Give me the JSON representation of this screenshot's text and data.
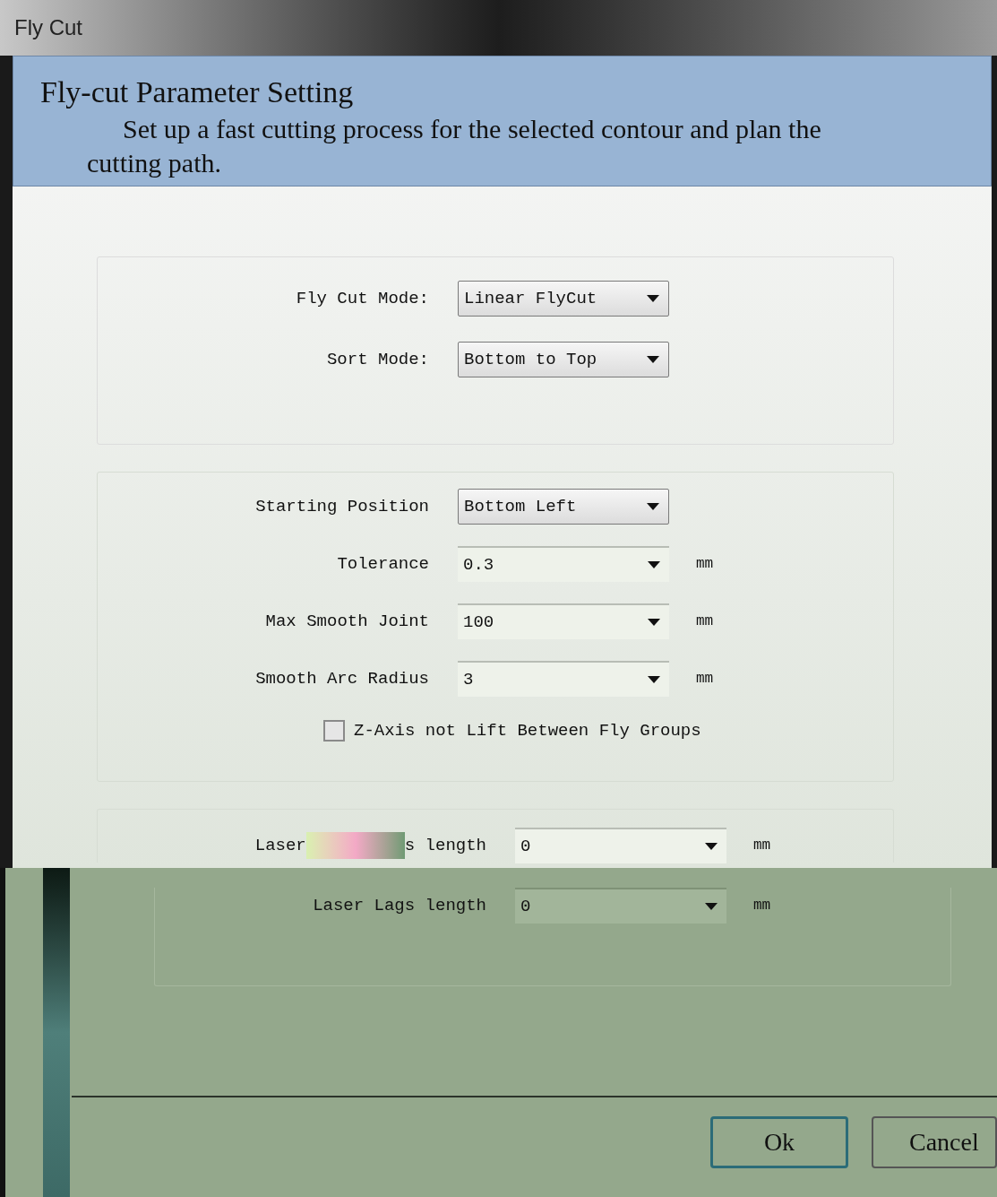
{
  "window": {
    "title": "Fly Cut"
  },
  "header": {
    "title": "Fly-cut Parameter Setting",
    "description": "Set up a fast cutting process for the selected contour and plan the cutting path."
  },
  "group_1": {
    "rows": [
      {
        "label": "Fly Cut Mode:",
        "kind": "dropdown",
        "value": "Linear FlyCut"
      },
      {
        "label": "Sort Mode:",
        "kind": "dropdown",
        "value": "Bottom to Top"
      }
    ]
  },
  "group_2": {
    "rows": [
      {
        "label": "Starting Position",
        "kind": "dropdown",
        "value": "Bottom Left"
      },
      {
        "label": "Tolerance",
        "kind": "editable",
        "value": "0.3",
        "unit": "mm"
      },
      {
        "label": "Max Smooth Joint",
        "kind": "editable",
        "value": "100",
        "unit": "mm"
      },
      {
        "label": "Smooth Arc Radius",
        "kind": "editable",
        "value": "3",
        "unit": "mm"
      }
    ],
    "checkbox": {
      "label": "Z-Axis not Lift Between Fly Groups",
      "checked": false
    }
  },
  "group_3": {
    "rows": [
      {
        "label_start": "Laser",
        "label_end": "s length",
        "value": "0",
        "unit": "mm"
      },
      {
        "label": "Laser Lags length",
        "value": "0",
        "unit": "mm"
      }
    ]
  },
  "buttons": [
    {
      "label": "Ok",
      "default": true
    },
    {
      "label": "Cancel",
      "default": false
    }
  ]
}
